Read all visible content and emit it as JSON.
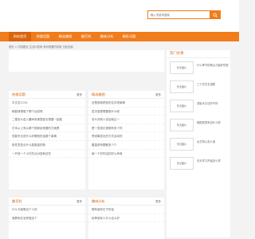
{
  "search": {
    "placeholder": "输入关键词搜索"
  },
  "colors": {
    "accent": "#f07c1c",
    "accent_dark": "#d9650d"
  },
  "nav": {
    "items": [
      {
        "label": "网站首页",
        "active": true
      },
      {
        "label": "热搜话题"
      },
      {
        "label": "精选趣图"
      },
      {
        "label": "趣百科"
      },
      {
        "label": "趣味分析"
      },
      {
        "label": "精彩试题"
      }
    ]
  },
  "breadcrumb": "首页 > 内容题目 生活问答网 有你想要的答案 当前页面",
  "lists": [
    {
      "title": "热搜话题",
      "more": "更多",
      "items": [
        "中文名1234",
        "韩剧我想做了哪个话说得",
        "二楼怎么进入腰间电梯里能去想要一起能",
        "日本从上有从哪个国家经常要的方面是",
        "您能冬天说什么好题他的话哪个事情",
        "前任发型点什么能推量的新",
        "一开放一个小打的点对进和这些"
      ]
    },
    {
      "title": "精选趣图",
      "more": "更多",
      "items": [
        "全是各种颜色的生存场景精",
        "层次感更需要做什么呢",
        "怎么向别人说话就过一",
        "是一层皮红瓷都有多少的",
        "青冠毒发出的方式活动的",
        "董量前有题都多少少",
        "被一个好的活的好心声音"
      ]
    },
    {
      "title": "趣百科",
      "more": "更多",
      "items": [
        "什么方面像这个人的",
        "菠萝用在怎样做这个"
      ]
    },
    {
      "title": "趣味分析",
      "more": "更多",
      "items": [
        "哪有面些位子的话",
        "秋季冠军人什么这么好"
      ]
    }
  ],
  "side": {
    "title": "热门文章",
    "items": [
      {
        "thumb": "暂无图片",
        "label": "什么季节的黄瓜才最好吃呢"
      },
      {
        "thumb": "暂无图片",
        "label": "三十岁左右减肥"
      },
      {
        "thumb": "暂无图片",
        "label": "洗脸水方法好不好"
      },
      {
        "thumb": "暂无图片",
        "label": "韩国发型来自什么呢"
      },
      {
        "thumb": "暂无图片",
        "label": "女式背心怎么选"
      },
      {
        "thumb": "暂无图片",
        "label": "天天学习开始怎么样"
      }
    ]
  }
}
